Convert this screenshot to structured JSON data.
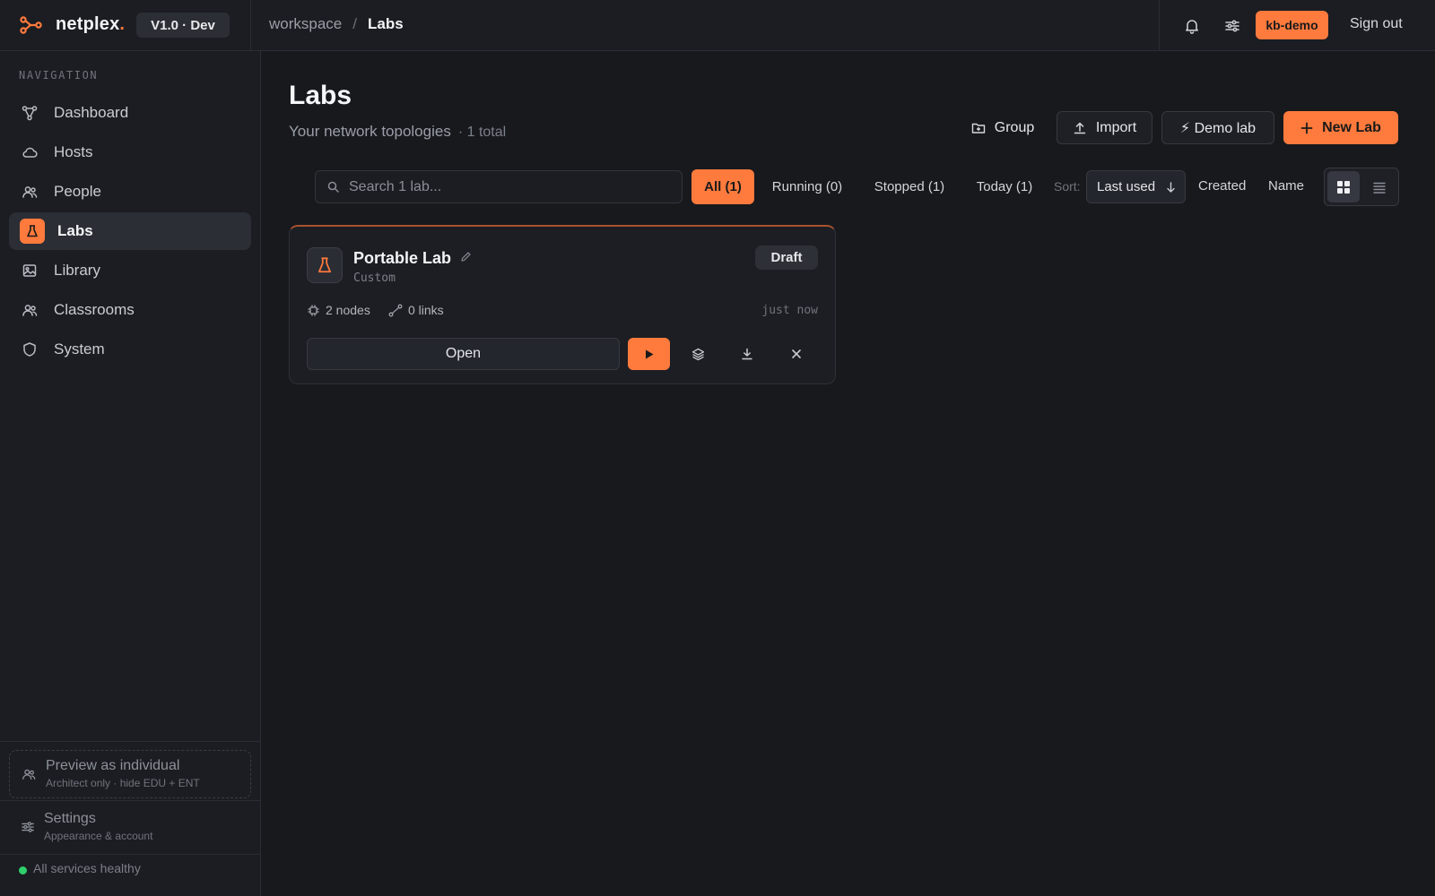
{
  "app": {
    "brand_name": "netplex",
    "brand_dot": ".",
    "version": "V1.0 · Dev",
    "accent_color": "#ff7a3d"
  },
  "breadcrumb": {
    "root": "workspace",
    "separator": "/",
    "current": "Labs"
  },
  "topbar": {
    "icons": [
      "bell-icon",
      "sliders-icon"
    ],
    "user_badge": "kb-demo",
    "sign_out": "Sign out"
  },
  "sidebar": {
    "heading": "NAVIGATION",
    "items": [
      {
        "label": "Dashboard",
        "icon": "topology-icon",
        "active": false
      },
      {
        "label": "Hosts",
        "icon": "cloud-icon",
        "active": false
      },
      {
        "label": "People",
        "icon": "users-icon",
        "active": false
      },
      {
        "label": "Labs",
        "icon": "flask-icon",
        "active": true
      },
      {
        "label": "Library",
        "icon": "image-icon",
        "active": false
      },
      {
        "label": "Classrooms",
        "icon": "users-icon",
        "active": false
      },
      {
        "label": "System",
        "icon": "shield-icon",
        "active": false
      }
    ],
    "preview": {
      "title": "Preview as individual",
      "subtitle": "Architect only · hide EDU + ENT"
    },
    "settings": {
      "title": "Settings",
      "subtitle": "Appearance & account"
    },
    "status": {
      "text": "All services healthy",
      "color": "#2fcf6b"
    }
  },
  "page": {
    "title": "Labs",
    "subtitle": "Your network topologies",
    "count": "· 1 total"
  },
  "actions": {
    "group": "Group",
    "import": "Import",
    "demo": "⚡ Demo lab",
    "new_lab": "New Lab"
  },
  "search": {
    "placeholder": "Search 1 lab...",
    "value": ""
  },
  "filters": [
    {
      "label": "All (1)",
      "active": true
    },
    {
      "label": "Running (0)",
      "active": false
    },
    {
      "label": "Stopped (1)",
      "active": false
    },
    {
      "label": "Today (1)",
      "active": false
    }
  ],
  "sort": {
    "label": "Sort:",
    "selected": "Last used",
    "options": [
      "Created",
      "Name"
    ]
  },
  "view": {
    "mode": "grid",
    "options": [
      "grid",
      "list"
    ]
  },
  "labs": [
    {
      "name": "Portable Lab",
      "type": "Custom",
      "status": "Draft",
      "nodes": "2 nodes",
      "links": "0 links",
      "updated": "just now",
      "open_label": "Open"
    }
  ]
}
